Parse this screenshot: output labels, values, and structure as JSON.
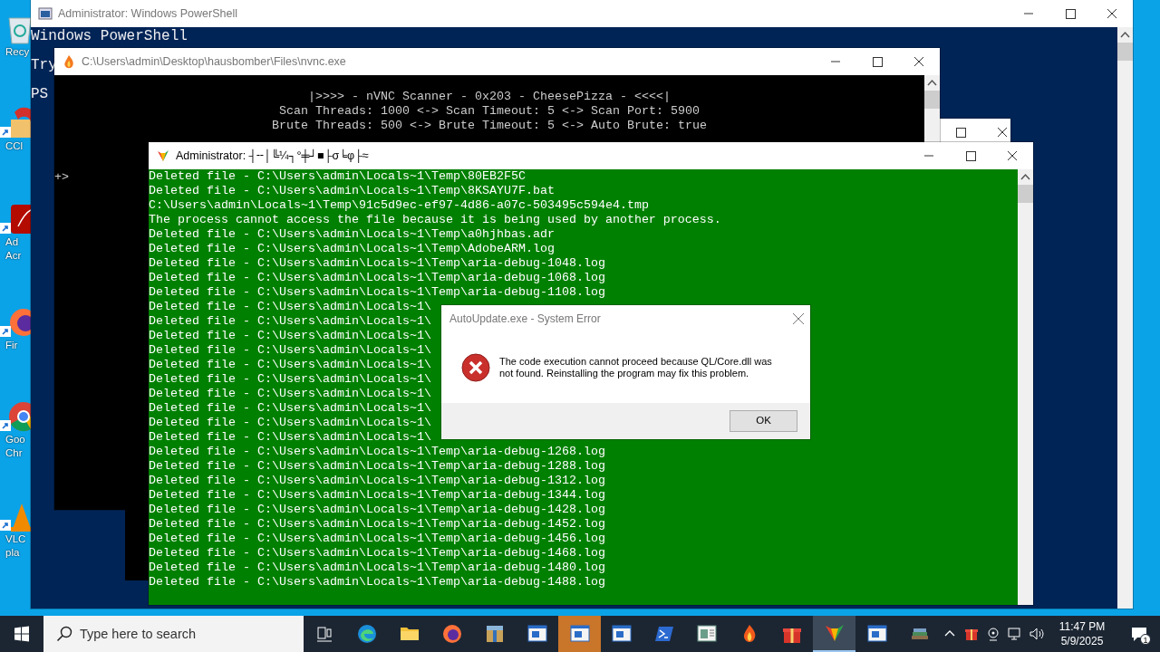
{
  "desktop_icons": [
    {
      "kind": "recycle",
      "lines": [
        "Recy"
      ]
    },
    {
      "kind": "ccleaner",
      "lines": [
        "CCl"
      ]
    },
    {
      "kind": "acrobat",
      "lines": [
        "Ad",
        "Acr"
      ]
    },
    {
      "kind": "firefox",
      "lines": [
        "Fir"
      ]
    },
    {
      "kind": "chrome",
      "lines": [
        "Goo",
        "Chr"
      ]
    },
    {
      "kind": "vlc",
      "lines": [
        "VLC",
        "pla"
      ]
    }
  ],
  "powershell": {
    "title": "Administrator: Windows PowerShell",
    "active": false,
    "lines": [
      "Windows PowerShell",
      "Try",
      "PS"
    ]
  },
  "nvnc": {
    "title": "C:\\Users\\admin\\Desktop\\hausbomber\\Files\\nvnc.exe",
    "active": false,
    "lines": [
      "|>>>> - nVNC Scanner - 0x203 - CheesePizza - <<<<|",
      "Scan Threads: 1000 <-> Scan Timeout: 5 <-> Scan Port: 5900",
      "Brute Threads: 500 <-> Brute Timeout: 5 <-> Auto Brute: true"
    ],
    "prompt": "+>"
  },
  "cleaner": {
    "title": "Administrator: ┤╌│╚¼┐°╪┘■├σ╘φ├≈",
    "active": true,
    "lines": [
      "Deleted file - C:\\Users\\admin\\Locals~1\\Temp\\80EB2F5C",
      "Deleted file - C:\\Users\\admin\\Locals~1\\Temp\\8KSAYU7F.bat",
      "C:\\Users\\admin\\Locals~1\\Temp\\91c5d9ec-ef97-4d86-a07c-503495c594e4.tmp",
      "The process cannot access the file because it is being used by another process.",
      "Deleted file - C:\\Users\\admin\\Locals~1\\Temp\\a0hjhbas.adr",
      "Deleted file - C:\\Users\\admin\\Locals~1\\Temp\\AdobeARM.log",
      "Deleted file - C:\\Users\\admin\\Locals~1\\Temp\\aria-debug-1048.log",
      "Deleted file - C:\\Users\\admin\\Locals~1\\Temp\\aria-debug-1068.log",
      "Deleted file - C:\\Users\\admin\\Locals~1\\Temp\\aria-debug-1108.log",
      "Deleted file - C:\\Users\\admin\\Locals~1\\",
      "Deleted file - C:\\Users\\admin\\Locals~1\\",
      "Deleted file - C:\\Users\\admin\\Locals~1\\",
      "Deleted file - C:\\Users\\admin\\Locals~1\\",
      "Deleted file - C:\\Users\\admin\\Locals~1\\",
      "Deleted file - C:\\Users\\admin\\Locals~1\\",
      "Deleted file - C:\\Users\\admin\\Locals~1\\",
      "Deleted file - C:\\Users\\admin\\Locals~1\\",
      "Deleted file - C:\\Users\\admin\\Locals~1\\",
      "Deleted file - C:\\Users\\admin\\Locals~1\\",
      "Deleted file - C:\\Users\\admin\\Locals~1\\Temp\\aria-debug-1268.log",
      "Deleted file - C:\\Users\\admin\\Locals~1\\Temp\\aria-debug-1288.log",
      "Deleted file - C:\\Users\\admin\\Locals~1\\Temp\\aria-debug-1312.log",
      "Deleted file - C:\\Users\\admin\\Locals~1\\Temp\\aria-debug-1344.log",
      "Deleted file - C:\\Users\\admin\\Locals~1\\Temp\\aria-debug-1428.log",
      "Deleted file - C:\\Users\\admin\\Locals~1\\Temp\\aria-debug-1452.log",
      "Deleted file - C:\\Users\\admin\\Locals~1\\Temp\\aria-debug-1456.log",
      "Deleted file - C:\\Users\\admin\\Locals~1\\Temp\\aria-debug-1468.log",
      "Deleted file - C:\\Users\\admin\\Locals~1\\Temp\\aria-debug-1480.log",
      "Deleted file - C:\\Users\\admin\\Locals~1\\Temp\\aria-debug-1488.log"
    ]
  },
  "error_dialog": {
    "title": "AutoUpdate.exe - System Error",
    "message": "The code execution cannot proceed because QL/Core.dll was not found. Reinstalling the program may fix this problem.",
    "button": "OK"
  },
  "taskbar": {
    "search": {
      "placeholder": "Type here to search"
    },
    "apps": [
      {
        "kind": "task-view",
        "selected": false,
        "flashing": false
      },
      {
        "kind": "edge",
        "selected": false,
        "flashing": false
      },
      {
        "kind": "folder",
        "selected": false,
        "flashing": false
      },
      {
        "kind": "firefox",
        "selected": false,
        "flashing": false
      },
      {
        "kind": "archive",
        "selected": false,
        "flashing": false
      },
      {
        "kind": "window",
        "selected": false,
        "flashing": false
      },
      {
        "kind": "window",
        "selected": false,
        "flashing": true
      },
      {
        "kind": "window",
        "selected": false,
        "flashing": false
      },
      {
        "kind": "powershell",
        "selected": false,
        "flashing": false
      },
      {
        "kind": "document",
        "selected": false,
        "flashing": false
      },
      {
        "kind": "flame",
        "selected": false,
        "flashing": false
      },
      {
        "kind": "gift",
        "selected": false,
        "flashing": false
      },
      {
        "kind": "butterfly",
        "selected": true,
        "flashing": false
      },
      {
        "kind": "window",
        "selected": false,
        "flashing": false
      },
      {
        "kind": "books",
        "selected": false,
        "flashing": false
      }
    ],
    "tray": [
      {
        "kind": "chevron"
      },
      {
        "kind": "gift"
      },
      {
        "kind": "webcam"
      },
      {
        "kind": "network"
      },
      {
        "kind": "volume"
      }
    ],
    "time": "11:47 PM",
    "date": "5/9/2025",
    "notifications": "1"
  }
}
